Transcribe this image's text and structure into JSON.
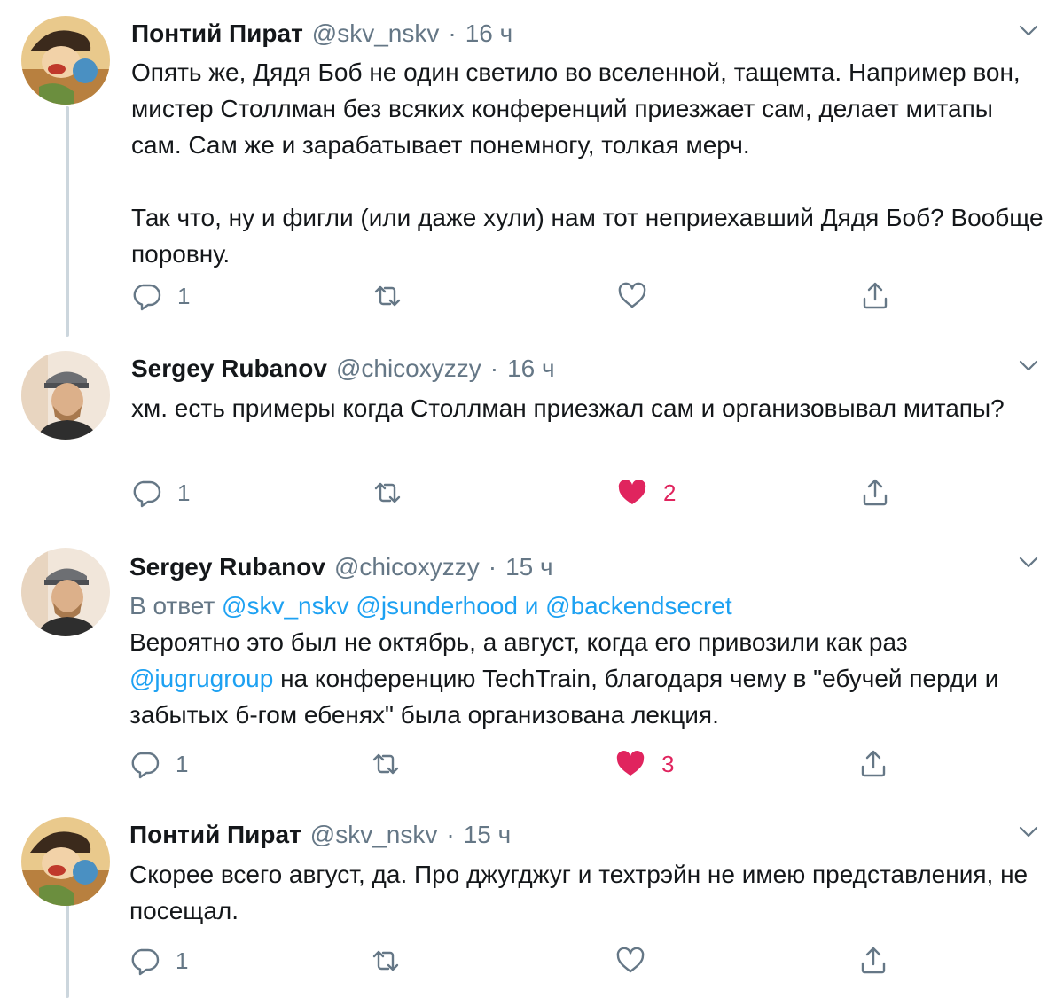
{
  "colors": {
    "accent": "#1da1f2",
    "secondary": "#657786",
    "like": "#e0245e",
    "thread_line": "#ccd6dd"
  },
  "tweets": [
    {
      "name": "Понтий Пират",
      "handle": "@skv_nskv",
      "dot": "·",
      "time": "16 ч",
      "paragraphs": [
        "Опять же, Дядя Боб не один светило во вселенной, тащемта. Например вон, мистер Столлман без всяких конференций приезжает сам, делает митапы сам. Сам же и зарабатывает понемногу, толкая мерч.",
        "Так что, ну и фигли (или даже хули) нам тот неприехавший Дядя Боб? Вообще поровну."
      ],
      "replies": "1",
      "likes": "",
      "liked": false
    },
    {
      "name": "Sergey Rubanov",
      "handle": "@chicoxyzzy",
      "dot": "·",
      "time": "16 ч",
      "paragraphs": [
        "хм. есть примеры когда Столлман приезжал сам и организовывал митапы?"
      ],
      "replies": "1",
      "likes": "2",
      "liked": true
    },
    {
      "name": "Sergey Rubanov",
      "handle": "@chicoxyzzy",
      "dot": "·",
      "time": "15 ч",
      "reply_to": {
        "prefix": "В ответ",
        "u1": "@skv_nskv",
        "u2": "@jsunderhood",
        "and": "и",
        "u3": "@backendsecret"
      },
      "text_mention": "@jugrugroup",
      "text_before": "Вероятно это был не октябрь, а август, когда его привозили как раз",
      "text_after": "на конференцию TechTrain, благодаря чему в \"ебучей перди и забытых б-гом ебенях\" была организована лекция.",
      "replies": "1",
      "likes": "3",
      "liked": true
    },
    {
      "name": "Понтий Пират",
      "handle": "@skv_nskv",
      "dot": "·",
      "time": "15 ч",
      "paragraphs": [
        "Скорее всего август, да. Про джугджуг и техтрэйн не имею представления, не посещал."
      ],
      "replies": "1",
      "likes": "",
      "liked": false
    }
  ]
}
